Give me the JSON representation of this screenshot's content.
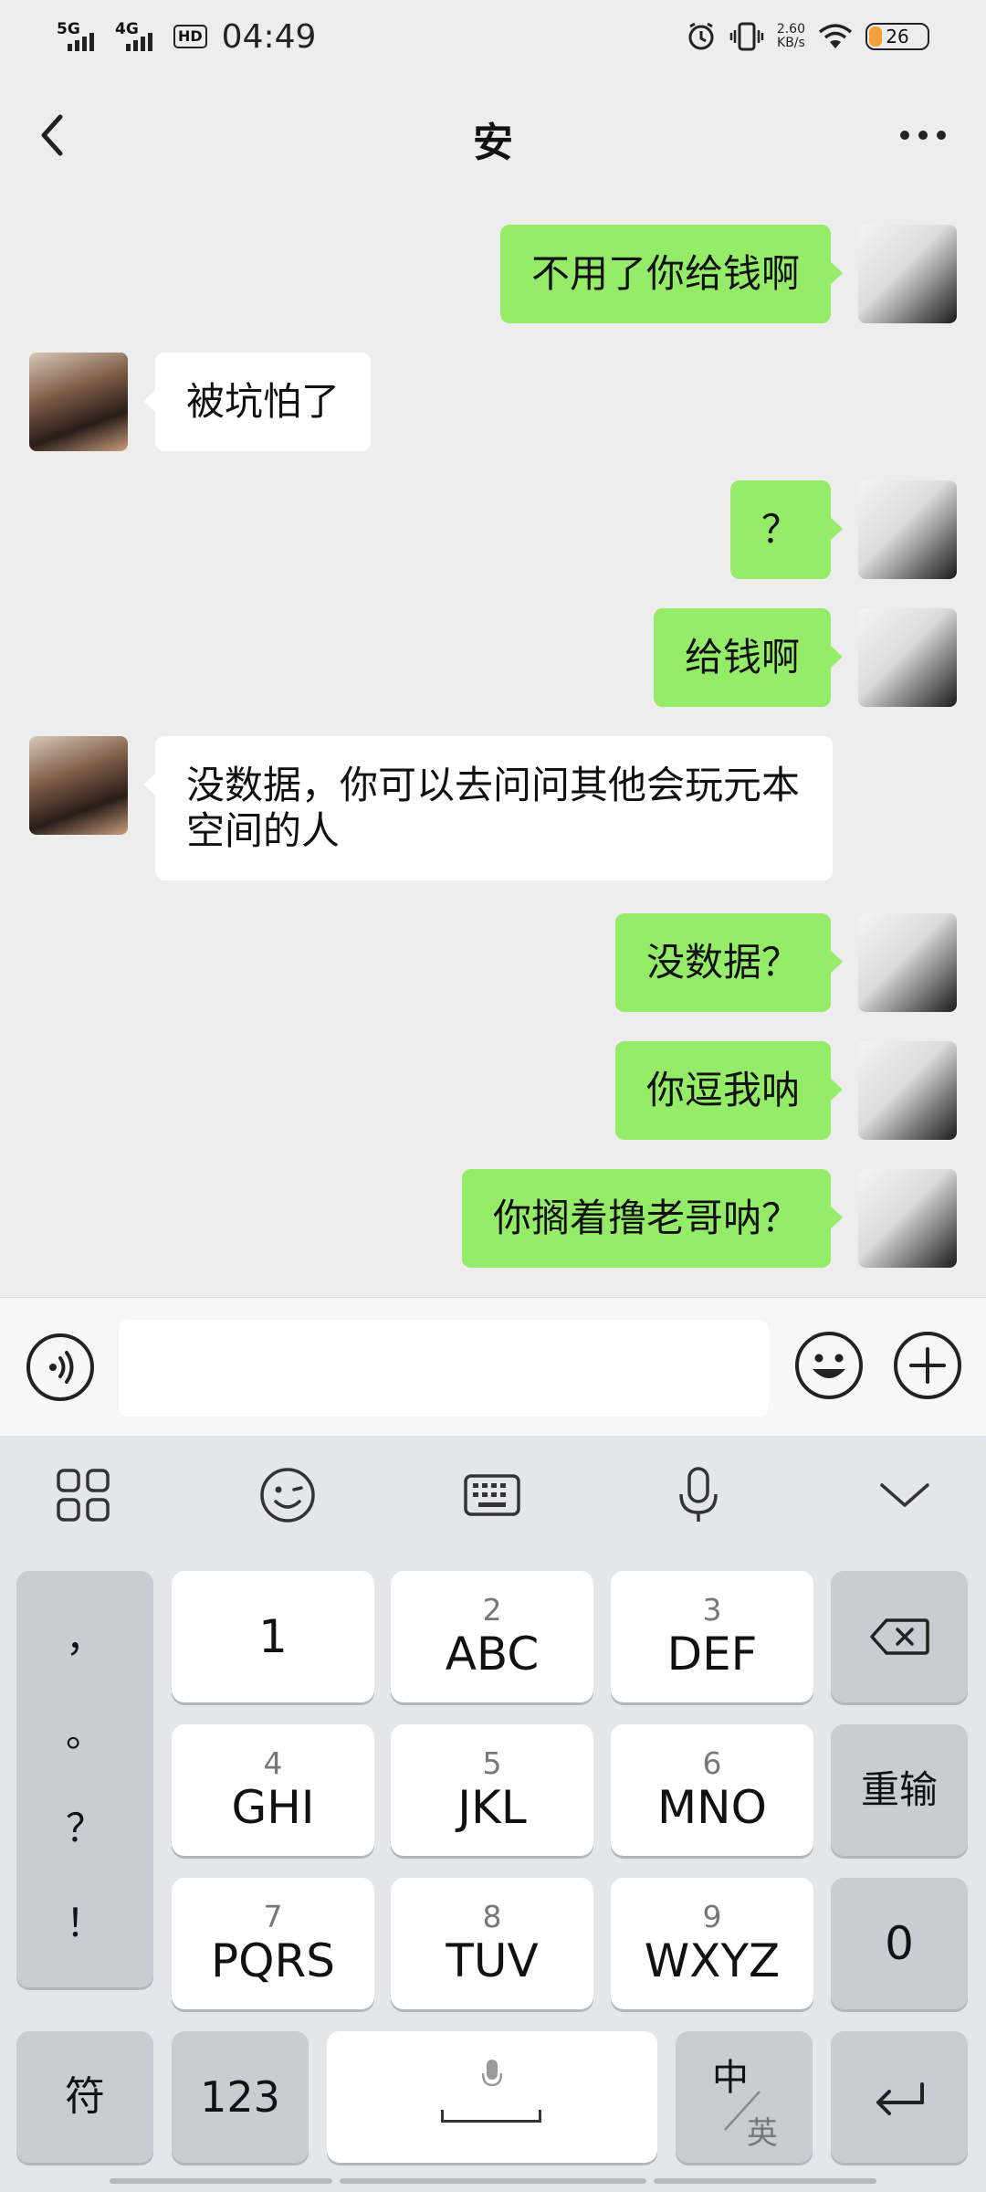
{
  "status_bar": {
    "signal_1": "5G",
    "signal_2": "4G",
    "hd": "HD",
    "time": "04:49",
    "speed_value": "2.60",
    "speed_unit": "KB/s",
    "battery": "26",
    "battery_color": "#f2a03b"
  },
  "header": {
    "title": "安"
  },
  "messages": [
    {
      "side": "self",
      "text": "不用了你给钱啊"
    },
    {
      "side": "other",
      "text": "被坑怕了"
    },
    {
      "side": "self",
      "text": "？"
    },
    {
      "side": "self",
      "text": "给钱啊"
    },
    {
      "side": "other",
      "text": "没数据，你可以去问问其他会玩元本空间的人"
    },
    {
      "side": "self",
      "text": "没数据？"
    },
    {
      "side": "self",
      "text": "你逗我呐"
    },
    {
      "side": "self",
      "text": "你搁着撸老哥呐？"
    }
  ],
  "input": {
    "value": ""
  },
  "keyboard": {
    "punct": [
      "，",
      "。",
      "？",
      "！"
    ],
    "keys": {
      "k1": {
        "main": "1"
      },
      "k2": {
        "sub": "2",
        "main": "ABC"
      },
      "k3": {
        "sub": "3",
        "main": "DEF"
      },
      "k4": {
        "sub": "4",
        "main": "GHI"
      },
      "k5": {
        "sub": "5",
        "main": "JKL"
      },
      "k6": {
        "sub": "6",
        "main": "MNO"
      },
      "k7": {
        "sub": "7",
        "main": "PQRS"
      },
      "k8": {
        "sub": "8",
        "main": "TUV"
      },
      "k9": {
        "sub": "9",
        "main": "WXYZ"
      },
      "reenter": "重输",
      "zero": "0",
      "symbols": "符",
      "numbers": "123",
      "lang_top": "中",
      "lang_bottom": "英"
    }
  },
  "colors": {
    "self_bubble": "#95ec69",
    "other_bubble": "#ffffff",
    "chat_bg": "#ededed"
  }
}
